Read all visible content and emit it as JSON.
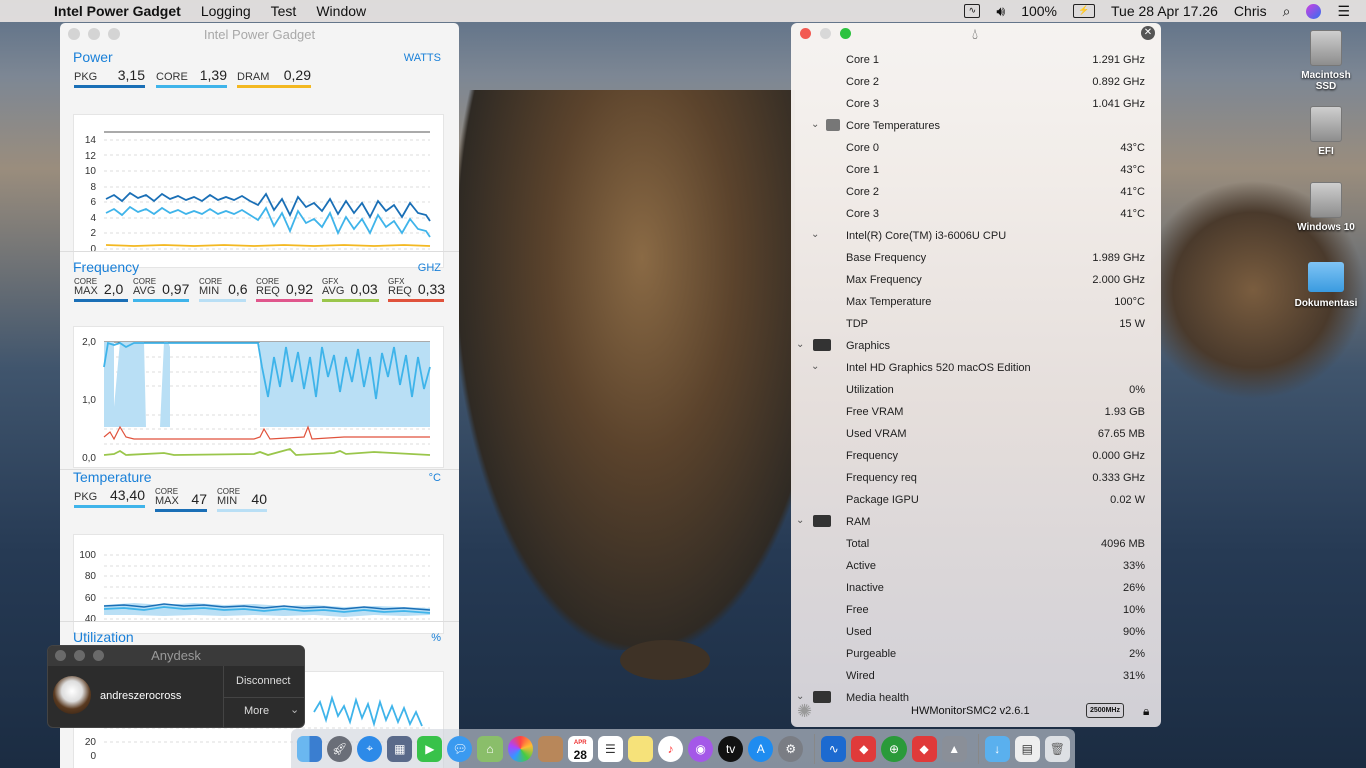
{
  "menubar": {
    "app": "Intel Power Gadget",
    "items": [
      "Logging",
      "Test",
      "Window"
    ],
    "battery": "100%",
    "clock": "Tue 28 Apr  17.26",
    "user": "Chris"
  },
  "ipg": {
    "title": "Intel Power Gadget",
    "power": {
      "head": "Power",
      "unit": "WATTS",
      "pkg_l": "PKG",
      "pkg": "3,15",
      "core_l": "CORE",
      "core": "1,39",
      "dram_l": "DRAM",
      "dram": "0,29",
      "yticks": [
        "14",
        "12",
        "10",
        "8",
        "6",
        "4",
        "2",
        "0"
      ]
    },
    "freq": {
      "head": "Frequency",
      "unit": "GHZ",
      "coremax_v": "2,0",
      "coreavg_v": "0,97",
      "coremin_v": "0,6",
      "corereq_v": "0,92",
      "gfxavg_v": "0,03",
      "gfxreq_v": "0,33",
      "yticks": [
        "2,0",
        "1,0",
        "0,0"
      ]
    },
    "temp": {
      "head": "Temperature",
      "unit": "°C",
      "pkg_l": "PKG",
      "pkg": "43,40",
      "max_v": "47",
      "min_v": "40",
      "yticks": [
        "100",
        "80",
        "60",
        "40"
      ]
    },
    "util": {
      "head": "Utilization",
      "unit": "%",
      "yticks": [
        "20",
        "0"
      ]
    },
    "colors": {
      "pkg": "#1a6fb6",
      "core": "#3fb4ea",
      "dram": "#f3b821",
      "coremin": "#b9dff5",
      "req": "#e0568c",
      "gfx": "#9ac64b",
      "gfxreq": "#e0523c"
    }
  },
  "hwm": {
    "rows": [
      {
        "n": "Core 1",
        "v": "1.291 GHz"
      },
      {
        "n": "Core 2",
        "v": "0.892 GHz"
      },
      {
        "n": "Core 3",
        "v": "1.041 GHz"
      },
      {
        "n": "Core Temperatures",
        "v": "",
        "g": 1
      },
      {
        "n": "Core 0",
        "v": "43°C"
      },
      {
        "n": "Core 1",
        "v": "43°C"
      },
      {
        "n": "Core 2",
        "v": "41°C"
      },
      {
        "n": "Core 3",
        "v": "41°C"
      },
      {
        "n": "Intel(R) Core(TM) i3-6006U CPU",
        "v": "",
        "g": 2
      },
      {
        "n": "Base Frequency",
        "v": "1.989 GHz"
      },
      {
        "n": "Max Frequency",
        "v": "2.000 GHz"
      },
      {
        "n": "Max Temperature",
        "v": "100°C"
      },
      {
        "n": "TDP",
        "v": "15 W"
      },
      {
        "n": "Graphics",
        "v": "",
        "g": 3
      },
      {
        "n": "Intel HD Graphics 520 macOS Edition",
        "v": "",
        "g": 2
      },
      {
        "n": "Utilization",
        "v": "0%"
      },
      {
        "n": "Free VRAM",
        "v": "1.93 GB"
      },
      {
        "n": "Used VRAM",
        "v": "67.65 MB"
      },
      {
        "n": "Frequency",
        "v": "0.000 GHz"
      },
      {
        "n": "Frequency req",
        "v": "0.333 GHz"
      },
      {
        "n": "Package IGPU",
        "v": "0.02 W"
      },
      {
        "n": "RAM",
        "v": "",
        "g": 3
      },
      {
        "n": "Total",
        "v": "4096 MB"
      },
      {
        "n": "Active",
        "v": "33%"
      },
      {
        "n": "Inactive",
        "v": "26%"
      },
      {
        "n": "Free",
        "v": "10%"
      },
      {
        "n": "Used",
        "v": "90%"
      },
      {
        "n": "Purgeable",
        "v": "2%"
      },
      {
        "n": "Wired",
        "v": "31%"
      },
      {
        "n": "Media health",
        "v": "",
        "g": 3
      }
    ],
    "footer": "HWMonitorSMC2 v2.6.1",
    "badge": "2500MHz"
  },
  "anydesk": {
    "title": "Anydesk",
    "user": "andreszerocross",
    "disconnect": "Disconnect",
    "more": "More"
  },
  "desktop": [
    {
      "label": "Macintosh SSD",
      "kind": "drive"
    },
    {
      "label": "EFI",
      "kind": "drive"
    },
    {
      "label": "Windows 10",
      "kind": "drive"
    },
    {
      "label": "Dokumentasi",
      "kind": "folder"
    }
  ],
  "dock": {
    "calendar_day": "28"
  }
}
